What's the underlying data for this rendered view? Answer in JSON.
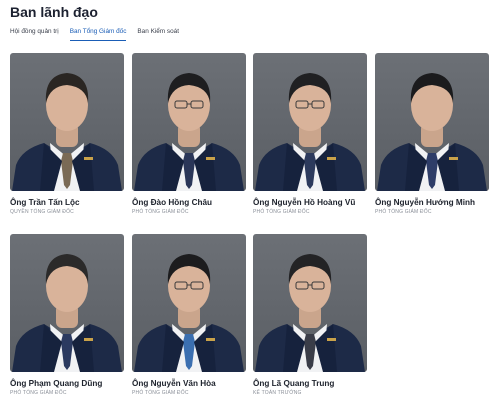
{
  "page": {
    "title": "Ban lãnh đạo"
  },
  "tabs": [
    {
      "label": "Hội đồng quản trị"
    },
    {
      "label": "Ban Tổng Giám đốc"
    },
    {
      "label": "Ban Kiểm soát"
    }
  ],
  "active_tab": "Ban Tổng Giám đốc",
  "colors": {
    "accent": "#1a5db6",
    "photo_background": "#63676d",
    "suit": "#1d2a47"
  },
  "leaders": [
    {
      "name": "Ông Trần Tấn Lộc",
      "role": "QUYỀN TỔNG GIÁM ĐỐC"
    },
    {
      "name": "Ông Đào Hồng Châu",
      "role": "PHÓ TỔNG GIÁM ĐỐC"
    },
    {
      "name": "Ông Nguyễn Hồ Hoàng Vũ",
      "role": "PHÓ TỔNG GIÁM ĐỐC"
    },
    {
      "name": "Ông Nguyễn Hướng Minh",
      "role": "PHÓ TỔNG GIÁM ĐỐC"
    },
    {
      "name": "Ông Phạm Quang Dũng",
      "role": "PHÓ TỔNG GIÁM ĐỐC"
    },
    {
      "name": "Ông Nguyễn Văn Hòa",
      "role": "PHÓ TỔNG GIÁM ĐỐC"
    },
    {
      "name": "Ông Lã Quang Trung",
      "role": "KẾ TOÁN TRƯỞNG"
    }
  ]
}
